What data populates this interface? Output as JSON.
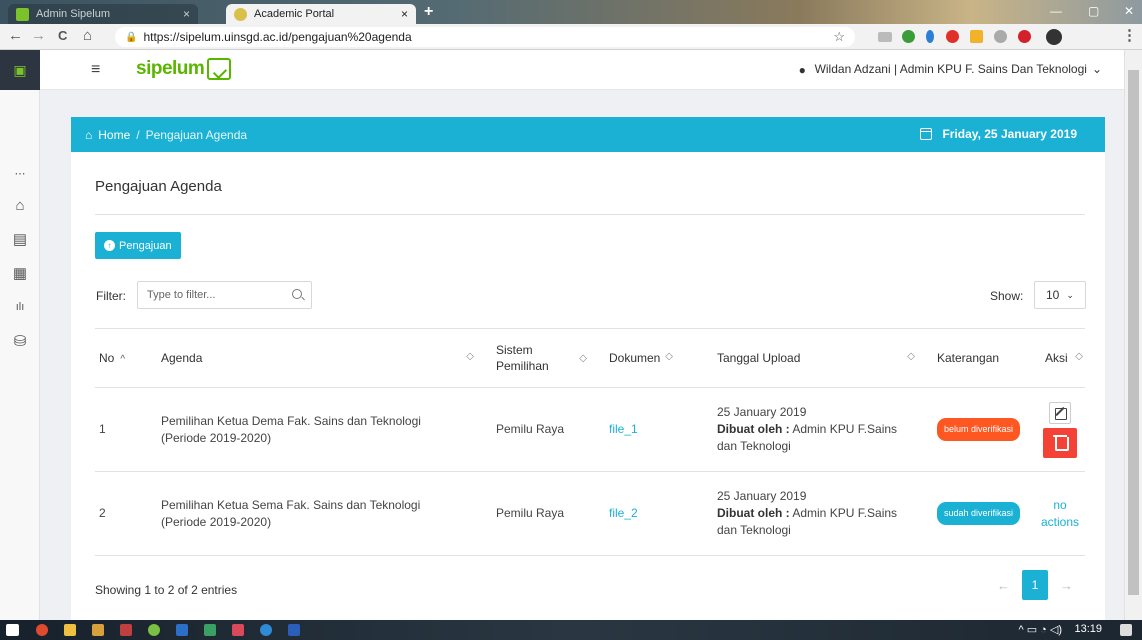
{
  "browser": {
    "tabs": [
      {
        "title": "Admin Sipelum",
        "close": "×",
        "icon_color": "#7cc22a"
      },
      {
        "title": "Academic Portal",
        "close": "×",
        "icon_color": "#d9c04a"
      }
    ],
    "new_tab": "+",
    "window_controls": {
      "minimize": "—",
      "maximize": "▢",
      "close": "✕"
    },
    "nav": {
      "back": "←",
      "forward": "→",
      "reload": "C",
      "home": "⌂"
    },
    "url": "https://sipelum.uinsgd.ac.id/pengajuan%20agenda",
    "lock_icon": "lock-icon",
    "bookmark": "☆",
    "menu": "⋮"
  },
  "app": {
    "logo_text": "sipelum",
    "menu_icon": "≡",
    "user": "Wildan Adzani | Admin KPU F. Sains Dan Teknologi",
    "user_chevron": "⌄",
    "sidebar_icons": [
      "⋯",
      "⌂",
      "▤",
      "▦",
      "ılı",
      "⛁"
    ]
  },
  "breadcrumb": {
    "home": "Home",
    "separator": "/",
    "current": "Pengajuan Agenda",
    "date": "Friday, 25 January 2019"
  },
  "page": {
    "title": "Pengajuan Agenda",
    "add_button": "Pengajuan",
    "filter_label": "Filter:",
    "filter_placeholder": "Type to filter...",
    "show_label": "Show:",
    "show_value": "10",
    "show_chevron": "⌄"
  },
  "table": {
    "headers": {
      "no": "No",
      "agenda": "Agenda",
      "sistem": "Sistem Pemilihan",
      "dokumen": "Dokumen",
      "tanggal": "Tanggal Upload",
      "keterangan": "Katerangan",
      "aksi": "Aksi"
    },
    "sort_asc": "^",
    "sort_both": "◇",
    "rows": [
      {
        "no": "1",
        "agenda": "Pemilihan Ketua Dema Fak. Sains dan Teknologi (Periode 2019-2020)",
        "sistem": "Pemilu Raya",
        "dokumen": "file_1",
        "tanggal": "25 January 2019",
        "dibuat_label": "Dibuat oleh :",
        "dibuat_oleh": "Admin KPU F.Sains dan Teknologi",
        "status": "belum diverifikasi",
        "status_color": "#ff5722"
      },
      {
        "no": "2",
        "agenda": "Pemilihan Ketua Sema Fak. Sains dan Teknologi (Periode 2019-2020)",
        "sistem": "Pemilu Raya",
        "dokumen": "file_2",
        "tanggal": "25 January 2019",
        "dibuat_label": "Dibuat oleh :",
        "dibuat_oleh": "Admin KPU F.Sains dan Teknologi",
        "status": "sudah diverifikasi",
        "status_color": "#1ab1d5",
        "no_actions": "no actions"
      }
    ]
  },
  "footer": {
    "entries": "Showing 1 to 2 of 2 entries",
    "prev": "←",
    "page": "1",
    "next": "→"
  },
  "taskbar": {
    "time": "13:19",
    "tray": "^ ▭ ◔ ◁)"
  },
  "colors": {
    "accent": "#1ab1d5",
    "danger": "#f44336",
    "brand": "#59b500"
  }
}
